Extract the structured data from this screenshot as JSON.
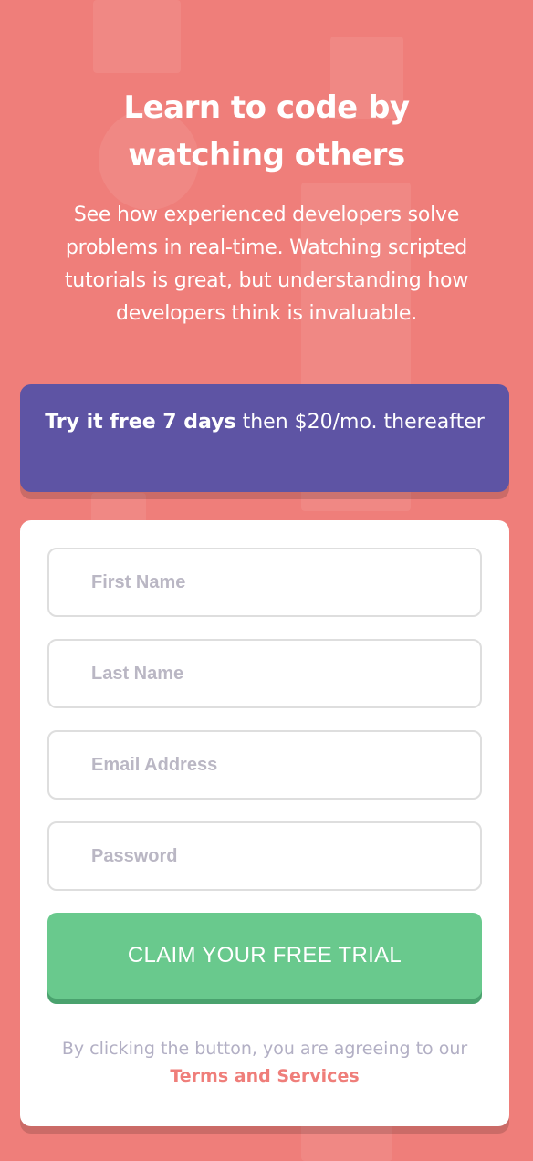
{
  "hero": {
    "title": "Learn to code by watching others",
    "description": "See how experienced developers solve problems in real-time. Watching scripted tutorials is great, but understanding how developers think is invaluable."
  },
  "promo": {
    "bold_text": "Try it free 7 days",
    "text": " then $20/mo. thereafter"
  },
  "form": {
    "fields": [
      {
        "placeholder": "First Name",
        "value": ""
      },
      {
        "placeholder": "Last Name",
        "value": ""
      },
      {
        "placeholder": "Email Address",
        "value": ""
      },
      {
        "placeholder": "Password",
        "value": ""
      }
    ],
    "submit_label": "CLAIM YOUR FREE TRIAL",
    "terms_prefix": "By clicking the button, you are agreeing to our ",
    "terms_link": "Terms and Services"
  },
  "colors": {
    "background": "#ef7e7a",
    "promo": "#5e54a4",
    "cta": "#69c98d",
    "link": "#ef7e7a"
  }
}
